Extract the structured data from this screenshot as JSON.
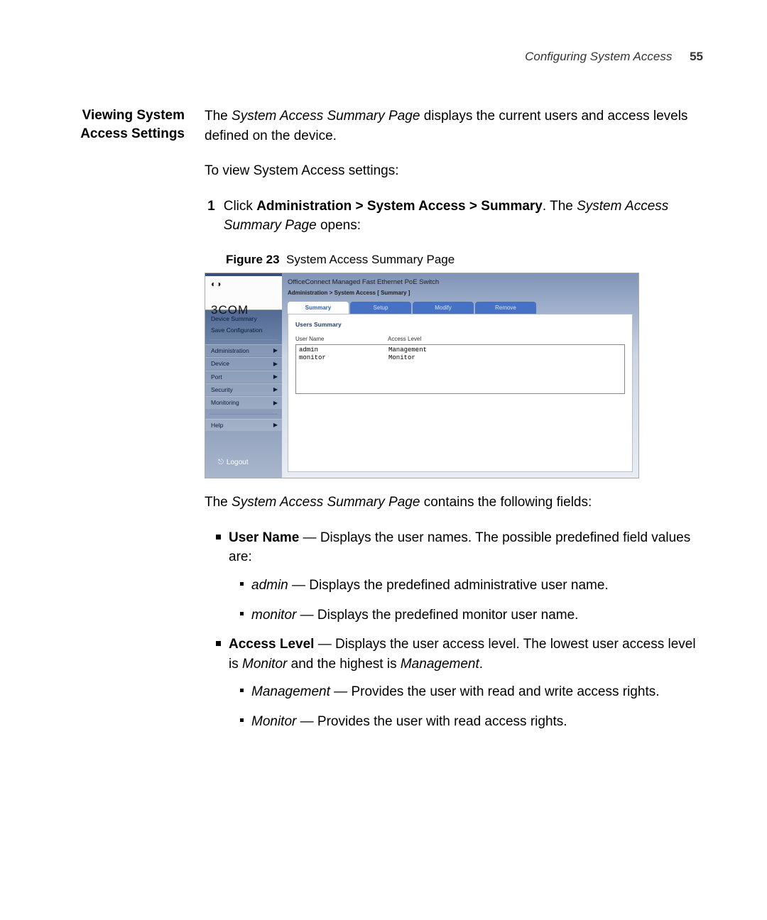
{
  "page": {
    "running_head": "Configuring System Access",
    "page_number": "55"
  },
  "section": {
    "side_title_l1": "Viewing System",
    "side_title_l2": "Access Settings",
    "intro_1a": "The ",
    "intro_1b": "System Access Summary Page",
    "intro_1c": " displays the current users and access levels defined on the device.",
    "intro_2": "To view System Access settings:",
    "step_num": "1",
    "step_a": "Click ",
    "step_b": "Administration > System Access > Summary",
    "step_c": ". The ",
    "step_d": "System Access Summary Page",
    "step_e": " opens:"
  },
  "figure": {
    "label": "Figure 23",
    "caption": "System Access Summary Page"
  },
  "screenshot": {
    "brand": "3COM",
    "product_title": "OfficeConnect Managed Fast Ethernet PoE Switch",
    "breadcrumb": "Administration > System Access [ Summary ]",
    "sidebar_top": [
      "Device Summary",
      "Save Configuration"
    ],
    "sidebar_menu": [
      "Administration",
      "Device",
      "Port",
      "Security",
      "Monitoring"
    ],
    "sidebar_help": "Help",
    "logout": "Logout",
    "tabs": [
      "Summary",
      "Setup",
      "Modify",
      "Remove"
    ],
    "panel_title": "Users Summary",
    "cols": [
      "User Name",
      "Access Level"
    ],
    "rows": [
      {
        "user": "admin",
        "level": "Management"
      },
      {
        "user": "monitor",
        "level": "Monitor"
      }
    ]
  },
  "after": {
    "lead_a": "The ",
    "lead_b": "System Access Summary Page",
    "lead_c": " contains the following fields:",
    "f1_label": "User Name",
    "f1_text": " — Displays the user names. The possible predefined field values are:",
    "f1a_label": "admin",
    "f1a_text": " — Displays the predefined administrative user name.",
    "f1b_label": "monitor",
    "f1b_text": " — Displays the predefined monitor user name.",
    "f2_label": "Access Level",
    "f2_text_a": " — Displays the user access level. The lowest user access level is ",
    "f2_text_b": "Monitor",
    "f2_text_c": " and the highest is ",
    "f2_text_d": "Management",
    "f2_text_e": ".",
    "f2a_label": "Management",
    "f2a_text": " — Provides the user with read and write access rights.",
    "f2b_label": "Monitor",
    "f2b_text": " — Provides the user with read access rights."
  }
}
